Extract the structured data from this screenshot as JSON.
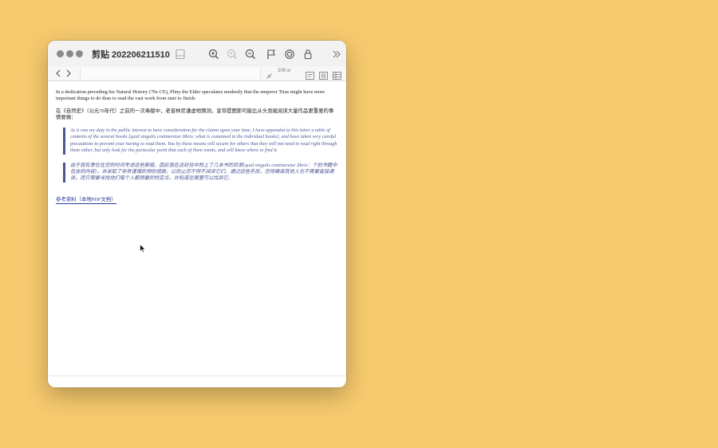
{
  "window": {
    "title": "剪贴 202206211510"
  },
  "toolbar": {
    "icons": [
      "sidebar-icon",
      "zoom-in-icon",
      "zoom-fit-icon",
      "zoom-out-icon",
      "flag-icon",
      "target-icon",
      "lock-icon",
      "more-chevrons-icon"
    ]
  },
  "nav": {
    "word_count": "206 w"
  },
  "article": {
    "intro_en": "In a dedication preceding his Natural History (70s CE), Pliny the Elder speculates modestly that the emperor Titus might have more important things to do than to read the vast work from start to finish:",
    "intro_zh": "在《自然史》（公元70年代）之前的一次奉献中，老普林尼谦虚地猜测，皇帝提图斯可能比从头到尾阅读大量作品更重要的事情要做：",
    "quote_en": "As it was my duty in the public interest to have consideration for the claims upon your time, I have appended to this letter a table of contents of the several books [quid singulis contineretur libris: what is contained in the individual books], and have taken very careful precautions to prevent your having to read them. You by these means will secure for others that they will not need to read right through them either, but only look for the particular point that each of them wants, and will know where to find it.",
    "quote_zh": "由于我有责任在您的时间考虑这些索赔，因此我在这封信中附上了几本书的目录[quid singulis contineretur libris：个别书籍中包含的内容]，并采取了非常谨慎的预防措施，以防止您不得不阅读它们。通过这些手段，您将确保其他人也不需要直接通读，而只需要寻找他们每个人都想要的特定点，并知道在哪里可以找到它。",
    "ref_link": "参考资料（本地PDF文档）"
  },
  "colors": {
    "desktop": "#f7ca6e",
    "quote_accent": "#4b5594",
    "link": "#2a3a9a"
  }
}
